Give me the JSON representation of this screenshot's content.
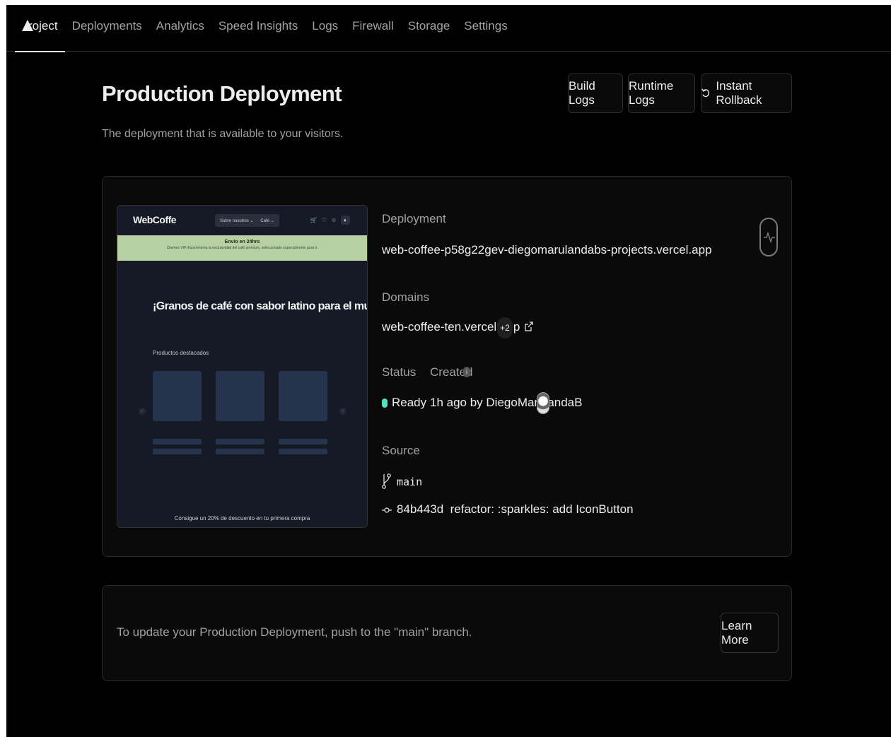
{
  "tabs": [
    {
      "label": "roject"
    },
    {
      "label": "Deployments"
    },
    {
      "label": "Analytics"
    },
    {
      "label": "Speed Insights"
    },
    {
      "label": "Logs"
    },
    {
      "label": "Firewall"
    },
    {
      "label": "Storage"
    },
    {
      "label": "Settings"
    }
  ],
  "header": {
    "title": "Production Deployment",
    "subtitle": "The deployment that is available to your visitors.",
    "build_logs": "Build Logs",
    "runtime_logs": "Runtime Logs",
    "instant_rollback": "Instant Rollback"
  },
  "preview": {
    "logo": "WebCoffe",
    "menu": [
      "Sobre nosotros ⌄",
      "Cafe ⌄"
    ],
    "banner_title": "Envío en 24hrs",
    "banner_text": "Clientes VIP. Experimenta la exclusividad del café premium, seleccionado especialmente para ti.",
    "hero": "¡Granos de café con sabor latino para el mundo!",
    "products_label": "Productos destacados",
    "footer": "Consigue un 20% de descuento en tu primera compra"
  },
  "deployment": {
    "label": "Deployment",
    "url": "web-coffee-p58g22gev-diegomarulandabs-projects.vercel.app"
  },
  "domains": {
    "label": "Domains",
    "primary": "web-coffee-ten.vercel.app",
    "extra_count": "+2"
  },
  "status": {
    "label": "Status",
    "value": "Ready",
    "color": "#50e3c2"
  },
  "created": {
    "label": "Created",
    "value": "1h ago by DiegoMarulandaB"
  },
  "source": {
    "label": "Source",
    "branch": "main",
    "commit_hash": "84b443d",
    "commit_message": "refactor: :sparkles: add IconButton"
  },
  "footer_card": {
    "text": "To update your Production Deployment, push to the \"main\" branch.",
    "learn_more": "Learn More"
  }
}
